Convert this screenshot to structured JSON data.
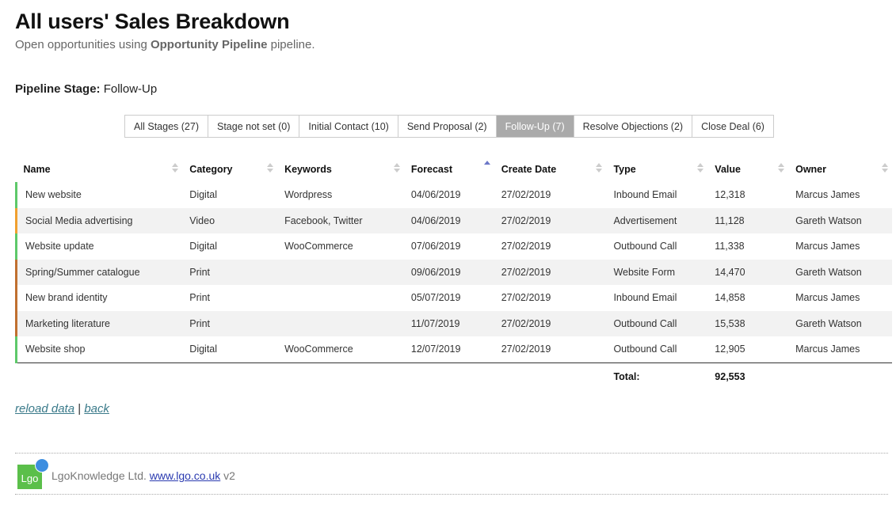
{
  "header": {
    "title": "All users' Sales Breakdown",
    "subtitle_prefix": "Open opportunities using ",
    "subtitle_pipeline": "Opportunity Pipeline",
    "subtitle_suffix": " pipeline.",
    "stage_label": "Pipeline Stage:",
    "stage_value": "Follow-Up"
  },
  "tabs": [
    {
      "label": "All Stages (27)",
      "active": false
    },
    {
      "label": "Stage not set (0)",
      "active": false
    },
    {
      "label": "Initial Contact (10)",
      "active": false
    },
    {
      "label": "Send Proposal (2)",
      "active": false
    },
    {
      "label": "Follow-Up (7)",
      "active": true
    },
    {
      "label": "Resolve Objections (2)",
      "active": false
    },
    {
      "label": "Close Deal (6)",
      "active": false
    }
  ],
  "table": {
    "columns": [
      "Name",
      "Category",
      "Keywords",
      "Forecast",
      "Create Date",
      "Type",
      "Value",
      "Owner"
    ],
    "sorted_column": "Forecast",
    "rows": [
      {
        "color": "green",
        "cells": [
          "New website",
          "Digital",
          "Wordpress",
          "04/06/2019",
          "27/02/2019",
          "Inbound Email",
          "12,318",
          "Marcus James"
        ]
      },
      {
        "color": "orange",
        "cells": [
          "Social Media advertising",
          "Video",
          "Facebook, Twitter",
          "04/06/2019",
          "27/02/2019",
          "Advertisement",
          "11,128",
          "Gareth Watson"
        ]
      },
      {
        "color": "green",
        "cells": [
          "Website update",
          "Digital",
          "WooCommerce",
          "07/06/2019",
          "27/02/2019",
          "Outbound Call",
          "11,338",
          "Marcus James"
        ]
      },
      {
        "color": "brown",
        "cells": [
          "Spring/Summer catalogue",
          "Print",
          "",
          "09/06/2019",
          "27/02/2019",
          "Website Form",
          "14,470",
          "Gareth Watson"
        ]
      },
      {
        "color": "brown",
        "cells": [
          "New brand identity",
          "Print",
          "",
          "05/07/2019",
          "27/02/2019",
          "Inbound Email",
          "14,858",
          "Marcus James"
        ]
      },
      {
        "color": "brown",
        "cells": [
          "Marketing literature",
          "Print",
          "",
          "11/07/2019",
          "27/02/2019",
          "Outbound Call",
          "15,538",
          "Gareth Watson"
        ]
      },
      {
        "color": "green",
        "cells": [
          "Website shop",
          "Digital",
          "WooCommerce",
          "12/07/2019",
          "27/02/2019",
          "Outbound Call",
          "12,905",
          "Marcus James"
        ]
      }
    ],
    "total_label": "Total:",
    "total_value": "92,553"
  },
  "links": {
    "reload": "reload data",
    "separator": "|",
    "back": "back"
  },
  "footer": {
    "logo_text": "Lgo",
    "company": "LgoKnowledge Ltd.",
    "url": "www.lgo.co.uk",
    "version": "v2"
  }
}
